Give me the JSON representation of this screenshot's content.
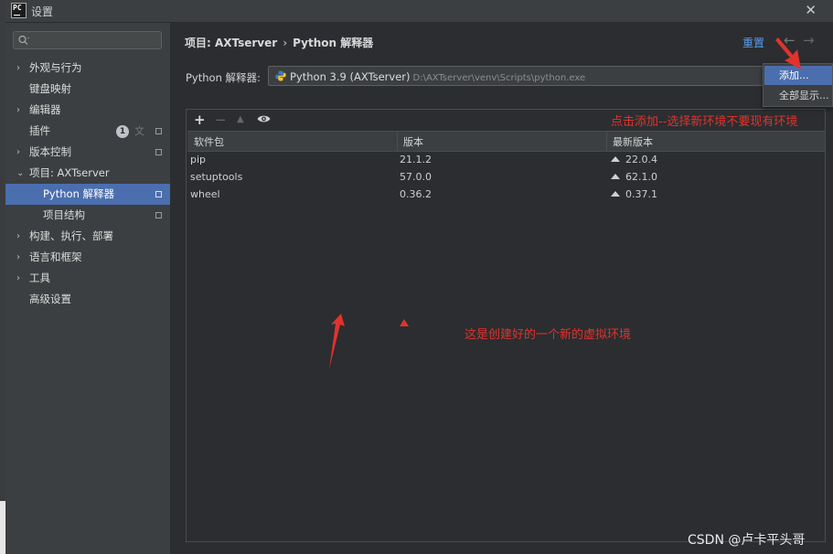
{
  "window": {
    "title": "设置",
    "logo_text": "PC"
  },
  "sidebar": {
    "search_placeholder": "",
    "items": [
      {
        "label": "外观与行为",
        "chevron": "›"
      },
      {
        "label": "键盘映射"
      },
      {
        "label": "编辑器",
        "chevron": "›"
      },
      {
        "label": "插件",
        "badge": "1"
      },
      {
        "label": "版本控制",
        "chevron": "›"
      },
      {
        "label": "项目: AXTserver",
        "chevron": "⌄"
      },
      {
        "label": "Python 解释器",
        "selected": true
      },
      {
        "label": "项目结构"
      },
      {
        "label": "构建、执行、部署",
        "chevron": "›"
      },
      {
        "label": "语言和框架",
        "chevron": "›"
      },
      {
        "label": "工具",
        "chevron": "›"
      },
      {
        "label": "高级设置"
      }
    ]
  },
  "header": {
    "breadcrumb_project": "项目: AXTserver",
    "breadcrumb_sep": "›",
    "breadcrumb_page": "Python 解释器",
    "reset_label": "重置"
  },
  "interpreter": {
    "label": "Python 解释器:",
    "name": "Python 3.9 (AXTserver)",
    "path": "D:\\AXTserver\\venv\\Scripts\\python.exe"
  },
  "toolbar": {
    "add": "+",
    "remove": "−",
    "upgrade": "▲"
  },
  "table": {
    "columns": [
      "软件包",
      "版本",
      "最新版本"
    ],
    "rows": [
      {
        "name": "pip",
        "version": "21.1.2",
        "latest": "22.0.4"
      },
      {
        "name": "setuptools",
        "version": "57.0.0",
        "latest": "62.1.0"
      },
      {
        "name": "wheel",
        "version": "0.36.2",
        "latest": "0.37.1"
      }
    ]
  },
  "menu": {
    "items": [
      "添加...",
      "全部显示..."
    ]
  },
  "annotations": {
    "top": "点击添加--选择新环境不要现有环境",
    "middle": "这是创建好的一个新的虚拟环境",
    "color": "#e0332d"
  },
  "watermark": "CSDN @卢卡平头哥",
  "colors": {
    "accent": "#4b6eaf",
    "link": "#589df6",
    "background": "#2b2d30",
    "sidebar": "#3c3f41"
  }
}
